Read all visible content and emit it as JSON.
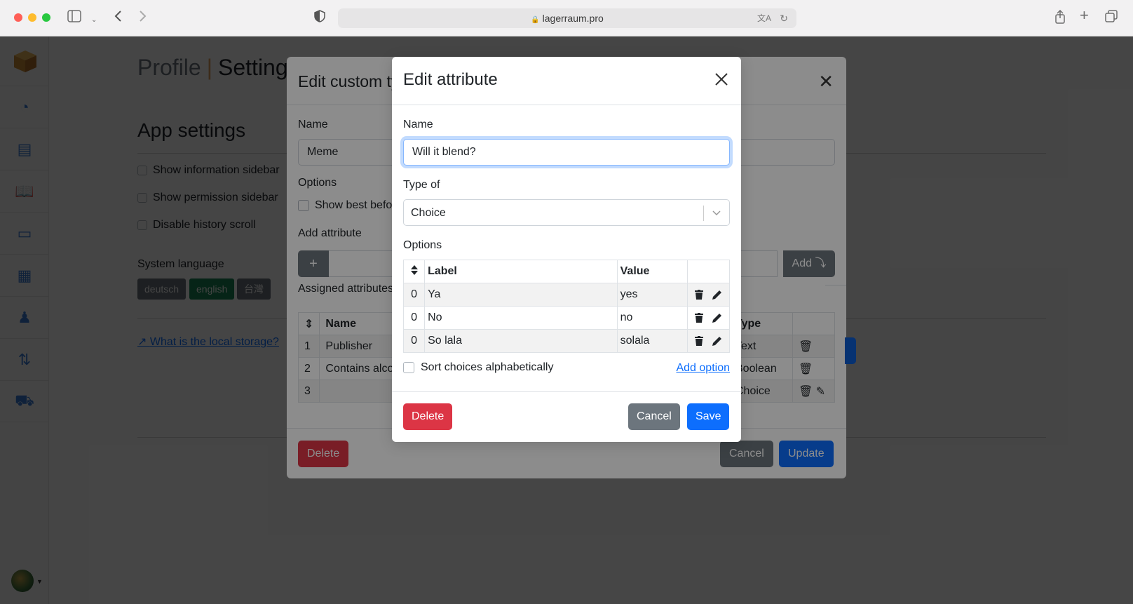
{
  "browser": {
    "url": "lagerraum.pro"
  },
  "background_page": {
    "title_profile": "Profile",
    "title_settings": "Settings",
    "section_title": "App settings",
    "checkboxes": [
      "Show information sidebar",
      "Show permission sidebar",
      "Disable history scroll"
    ],
    "language_label": "System language",
    "languages": [
      {
        "label": "deutsch",
        "color": "#6c757d"
      },
      {
        "label": "english",
        "color": "#198754"
      },
      {
        "label": "台灣",
        "color": "#6c757d"
      }
    ],
    "storage_link": "What is the local storage?"
  },
  "background_modal": {
    "title": "Edit custom type",
    "name_label": "Name",
    "name_value": "Meme",
    "options_label": "Options",
    "options_checkbox": "Show best before",
    "add_attribute_label": "Add attribute",
    "add_button": "Add",
    "assigned_label": "Assigned attributes",
    "table": {
      "headers": [
        "",
        "Name",
        "Type",
        ""
      ],
      "rows": [
        {
          "num": "1",
          "name": "Publisher",
          "type": "Text"
        },
        {
          "num": "2",
          "name": "Contains alcohol",
          "type": "Boolean"
        },
        {
          "num": "3",
          "name": "",
          "type": "Choice"
        }
      ]
    },
    "delete_button": "Delete",
    "cancel_button": "Cancel",
    "update_button": "Update"
  },
  "modal": {
    "title": "Edit attribute",
    "name_label": "Name",
    "name_value": "Will it blend?",
    "type_label": "Type of",
    "type_value": "Choice",
    "options_label": "Options",
    "table_headers": {
      "label": "Label",
      "value": "Value"
    },
    "options": [
      {
        "order": "0",
        "label": "Ya",
        "value": "yes"
      },
      {
        "order": "0",
        "label": "No",
        "value": "no"
      },
      {
        "order": "0",
        "label": "So lala",
        "value": "solala"
      }
    ],
    "sort_checkbox": "Sort choices alphabetically",
    "add_option": "Add option",
    "delete_button": "Delete",
    "cancel_button": "Cancel",
    "save_button": "Save"
  },
  "colors": {
    "primary": "#0d6efd",
    "danger": "#dc3545",
    "secondary": "#6c757d"
  }
}
